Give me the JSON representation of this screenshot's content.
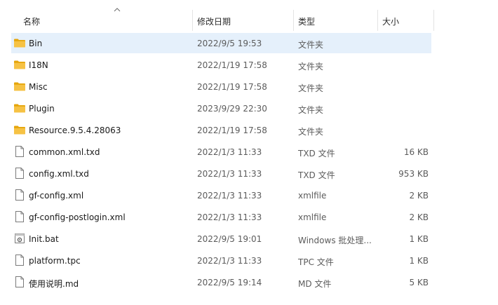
{
  "columns": {
    "name": "名称",
    "modified": "修改日期",
    "type": "类型",
    "size": "大小"
  },
  "sort": {
    "column": "name",
    "direction": "ascending"
  },
  "colors": {
    "selected_row": "#e5f0fb",
    "folder": "#f6c244",
    "folder_dark": "#e5a50a"
  },
  "rows": [
    {
      "name": "Bin",
      "modified": "2022/9/5 19:53",
      "type": "文件夹",
      "size": "",
      "icon": "folder-icon",
      "selected": true
    },
    {
      "name": "I18N",
      "modified": "2022/1/19 17:58",
      "type": "文件夹",
      "size": "",
      "icon": "folder-icon"
    },
    {
      "name": "Misc",
      "modified": "2022/1/19 17:58",
      "type": "文件夹",
      "size": "",
      "icon": "folder-icon"
    },
    {
      "name": "Plugin",
      "modified": "2023/9/29 22:30",
      "type": "文件夹",
      "size": "",
      "icon": "folder-icon"
    },
    {
      "name": "Resource.9.5.4.28063",
      "modified": "2022/1/19 17:58",
      "type": "文件夹",
      "size": "",
      "icon": "folder-icon"
    },
    {
      "name": "common.xml.txd",
      "modified": "2022/1/3 11:33",
      "type": "TXD 文件",
      "size": "16 KB",
      "icon": "file-icon"
    },
    {
      "name": "config.xml.txd",
      "modified": "2022/1/3 11:33",
      "type": "TXD 文件",
      "size": "953 KB",
      "icon": "file-icon"
    },
    {
      "name": "gf-config.xml",
      "modified": "2022/1/3 11:33",
      "type": "xmlfile",
      "size": "2 KB",
      "icon": "file-icon"
    },
    {
      "name": "gf-config-postlogin.xml",
      "modified": "2022/1/3 11:33",
      "type": "xmlfile",
      "size": "2 KB",
      "icon": "file-icon"
    },
    {
      "name": "Init.bat",
      "modified": "2022/9/5 19:01",
      "type": "Windows 批处理...",
      "size": "1 KB",
      "icon": "batch-file-icon"
    },
    {
      "name": "platform.tpc",
      "modified": "2022/1/3 11:33",
      "type": "TPC 文件",
      "size": "1 KB",
      "icon": "file-icon"
    },
    {
      "name": "使用说明.md",
      "modified": "2022/9/5 19:14",
      "type": "MD 文件",
      "size": "5 KB",
      "icon": "file-icon"
    }
  ]
}
